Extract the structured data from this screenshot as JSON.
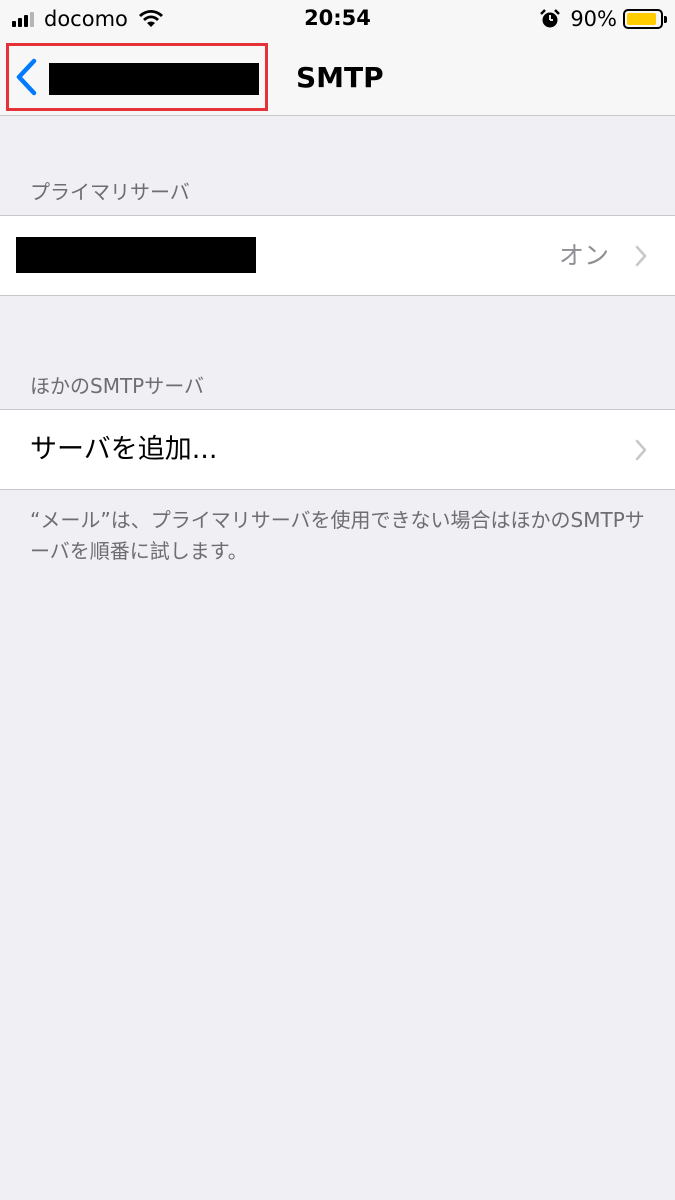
{
  "status_bar": {
    "carrier": "docomo",
    "time": "20:54",
    "battery_percent": "90%",
    "battery_level": 0.9,
    "icons": [
      "signal-icon",
      "wifi-icon",
      "alarm-icon",
      "battery-icon"
    ]
  },
  "nav": {
    "title": "SMTP",
    "back_icon": "chevron-left-icon"
  },
  "primary_server": {
    "header": "プライマリサーバ",
    "value": "オン"
  },
  "other_servers": {
    "header": "ほかのSMTPサーバ",
    "add_label": "サーバを追加..."
  },
  "footer": {
    "note": "“メール”は、プライマリサーバを使用できない場合はほかのSMTPサーバを順番に試します。"
  },
  "colors": {
    "background": "#efeff4",
    "tint": "#007aff",
    "highlight_border": "#e53238",
    "battery": "#ffcc00"
  }
}
